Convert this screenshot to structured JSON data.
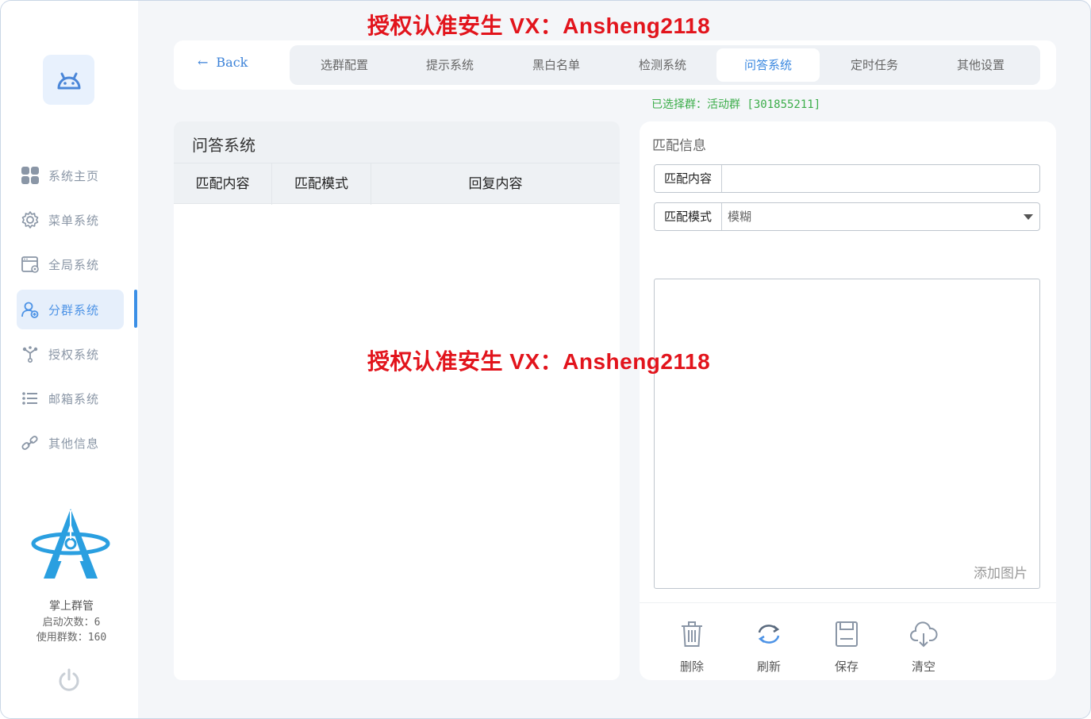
{
  "watermark": {
    "text": "授权认准安生 VX：Ansheng2118"
  },
  "sidebar": {
    "items": [
      {
        "label": "系统主页",
        "icon": "grid-icon"
      },
      {
        "label": "菜单系统",
        "icon": "gear-icon"
      },
      {
        "label": "全局系统",
        "icon": "window-settings-icon"
      },
      {
        "label": "分群系统",
        "icon": "user-group-icon"
      },
      {
        "label": "授权系统",
        "icon": "branch-icon"
      },
      {
        "label": "邮箱系统",
        "icon": "list-icon"
      },
      {
        "label": "其他信息",
        "icon": "link-icon"
      }
    ],
    "active_index": 3,
    "brand_name": "掌上群管",
    "launch_count": "启动次数：6",
    "group_count": "使用群数：160"
  },
  "topbar": {
    "back_label": "Back",
    "tabs": [
      "选群配置",
      "提示系统",
      "黑白名单",
      "检测系统",
      "问答系统",
      "定时任务",
      "其他设置"
    ],
    "active_tab": "问答系统"
  },
  "selected_group": "已选择群：活动群 [301855211]",
  "qa_table": {
    "title": "问答系统",
    "columns": [
      "匹配内容",
      "匹配模式",
      "回复内容"
    ],
    "rows": []
  },
  "form": {
    "title": "匹配信息",
    "match_content_label": "匹配内容",
    "match_content_value": "",
    "match_mode_label": "匹配模式",
    "match_mode_value": "模糊",
    "add_image_label": "添加图片",
    "actions": {
      "delete": "删除",
      "refresh": "刷新",
      "save": "保存",
      "clear": "清空"
    }
  },
  "colors": {
    "accent": "#3b88e0",
    "success": "#3cad4a",
    "watermark": "#e2141c"
  }
}
